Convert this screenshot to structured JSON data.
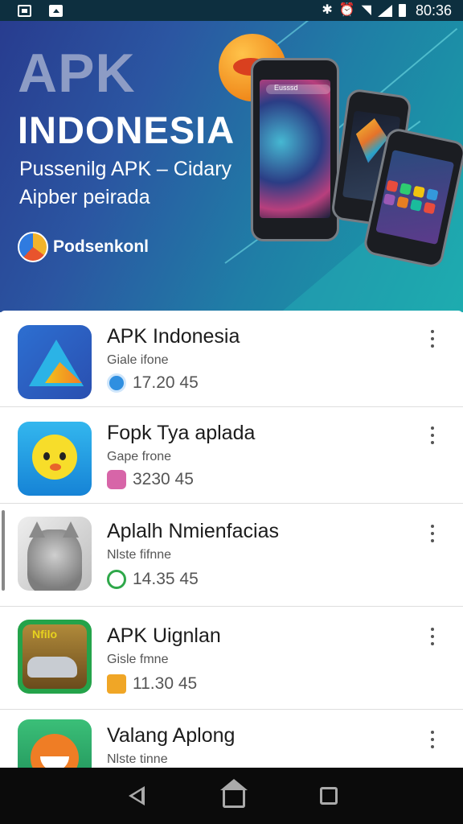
{
  "status_bar": {
    "time": "80:36",
    "icons": [
      "screenshot-icon",
      "upload-icon",
      "bluetooth-icon",
      "alarm-icon",
      "wifi-icon",
      "signal-icon",
      "battery-icon"
    ]
  },
  "banner": {
    "title_line1": "APK",
    "title_line2": "INDONESIA",
    "subtitle_line1": "Pussenilg APK – Cidary",
    "subtitle_line2": "Aipber peirada",
    "brand": "Podsenkonl",
    "phone_label": "Eusssd"
  },
  "apps": [
    {
      "title": "APK Indonesia",
      "subtitle": "Giale ifone",
      "meta": "17.20 45",
      "icon": "apk-triangle-icon"
    },
    {
      "title": "Fopk Tya aplada",
      "subtitle": "Gape frone",
      "meta": "3230 45",
      "icon": "yellow-bird-icon"
    },
    {
      "title": "Aplalh Nmienfacias",
      "subtitle": "Nlste fifnne",
      "meta": "14.35 45",
      "icon": "cat-icon"
    },
    {
      "title": "APK Uignlan",
      "subtitle": "Gisle fmne",
      "meta": "11.30 45",
      "icon": "car-game-icon"
    },
    {
      "title": "Valang Aplong",
      "subtitle": "Nlste tinne",
      "meta": "",
      "icon": "orange-creature-icon"
    }
  ],
  "colors": {
    "banner_start": "#283c8f",
    "banner_end": "#18a3a8",
    "status_bar": "#0d2f3f",
    "nav_bar": "#0b0b0b"
  }
}
